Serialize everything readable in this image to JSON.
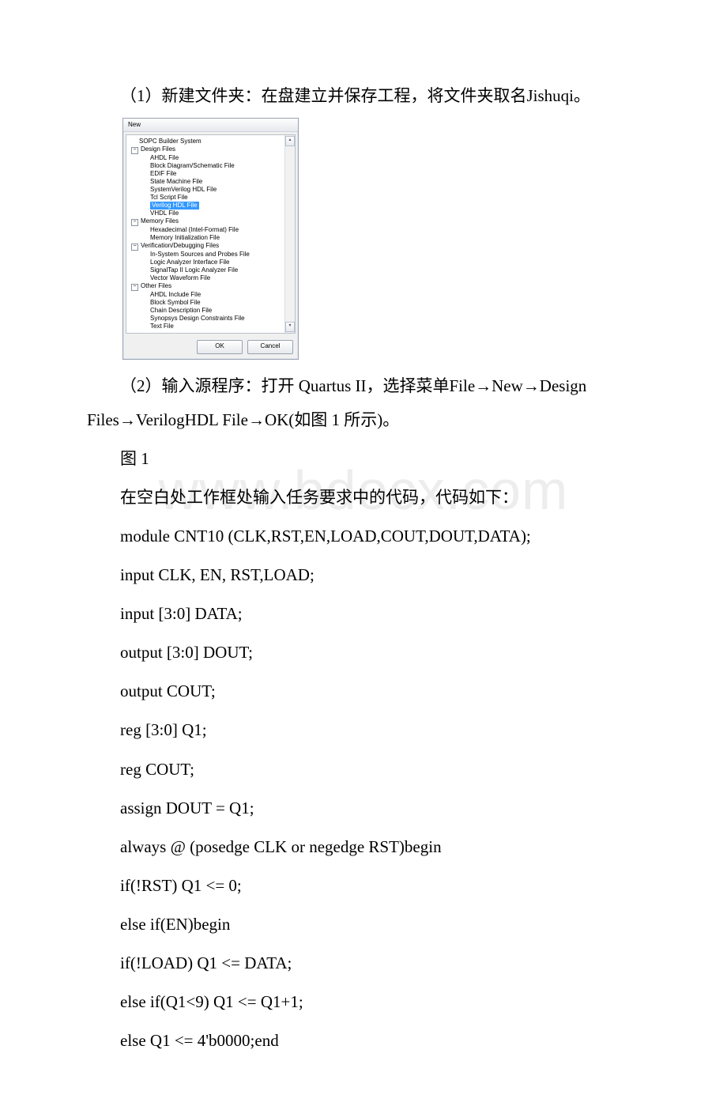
{
  "watermark": "www.bdocx.com",
  "p1": "（1）新建文件夹：在盘建立并保存工程，将文件夹取名Jishuqi。",
  "p2": "（2）输入源程序：打开 Quartus II，选择菜单File→New→Design Files→VerilogHDL File→OK(如图 1 所示)。",
  "fig": "图 1",
  "p3": "在空白处工作框处输入任务要求中的代码，代码如下：",
  "code": {
    "l1": "module CNT10 (CLK,RST,EN,LOAD,COUT,DOUT,DATA);",
    "l2": "input CLK, EN, RST,LOAD;",
    "l3": "input [3:0] DATA;",
    "l4": "output [3:0] DOUT;",
    "l5": "output COUT;",
    "l6": "reg [3:0] Q1;",
    "l7": "reg COUT;",
    "l8": "assign DOUT = Q1;",
    "l9": "always @ (posedge CLK or negedge RST)begin",
    "l10": " if(!RST) Q1 <= 0;",
    "l11": " else if(EN)begin",
    "l12": " if(!LOAD) Q1 <= DATA;",
    "l13": "  else if(Q1<9) Q1 <= Q1+1;",
    "l14": "  else Q1 <= 4'b0000;end"
  },
  "dialog": {
    "title": "New",
    "items": {
      "sopc": "SOPC Builder System",
      "design": "Design Files",
      "ahdl": "AHDL File",
      "block": "Block Diagram/Schematic File",
      "edif": "EDIF File",
      "state": "State Machine File",
      "sysv": "SystemVerilog HDL File",
      "tcl": "Tcl Script File",
      "verilog": "Verilog HDL File",
      "vhdl": "VHDL File",
      "memory": "Memory Files",
      "hex": "Hexadecimal (Intel-Format) File",
      "meminit": "Memory Initialization File",
      "verif": "Verification/Debugging Files",
      "insys": "In-System Sources and Probes File",
      "logic": "Logic Analyzer Interface File",
      "signal": "SignalTap II Logic Analyzer File",
      "vector": "Vector Waveform File",
      "other": "Other Files",
      "ahdlinc": "AHDL Include File",
      "blocksym": "Block Symbol File",
      "chain": "Chain Description File",
      "synopsys": "Synopsys Design Constraints File",
      "text": "Text File"
    },
    "ok": "OK",
    "cancel": "Cancel",
    "minus": "−",
    "up": "▴",
    "down": "▾"
  }
}
